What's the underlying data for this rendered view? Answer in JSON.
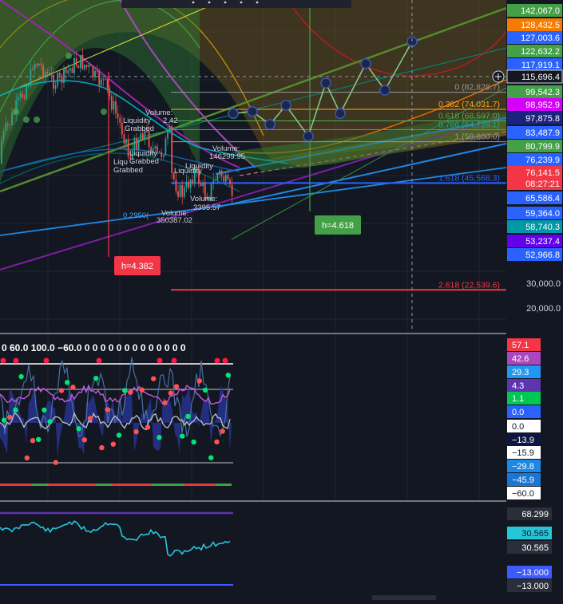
{
  "colors": {
    "background": "#131722",
    "grid": "#242a38",
    "divider": "#d1d4dc",
    "up": "#26a69a",
    "down": "#ef5350",
    "label_text": "#ffffff"
  },
  "price_axis": [
    {
      "label": "142,067.0",
      "value": 142067.0,
      "color": "#43a047"
    },
    {
      "label": "128,432.5",
      "value": 128432.5,
      "color": "#f57c00"
    },
    {
      "label": "127,003.6",
      "value": 127003.6,
      "color": "#2962ff"
    },
    {
      "label": "122,632.2",
      "value": 122632.2,
      "color": "#43a047"
    },
    {
      "label": "117,919.1",
      "value": 117919.1,
      "color": "#2962ff"
    },
    {
      "label": "115,696.4",
      "value": 115696.4,
      "color": "#131722"
    },
    {
      "label": "99,542.3",
      "value": 99542.3,
      "color": "#43a047"
    },
    {
      "label": "98,952.9",
      "value": 98952.9,
      "color": "#d500f9"
    },
    {
      "label": "97,875.8",
      "value": 97875.8,
      "color": "#1a237e"
    },
    {
      "label": "83,487.9",
      "value": 83487.9,
      "color": "#2962ff"
    },
    {
      "label": "80,799.9",
      "value": 80799.9,
      "color": "#43a047"
    },
    {
      "label": "76,239.9",
      "value": 76239.9,
      "color": "#2962ff"
    },
    {
      "label": "76,141.5",
      "value": 76141.5,
      "color": "#f23645"
    },
    {
      "label": "08:27:21",
      "value": null,
      "color": "#f23645"
    },
    {
      "label": "65,586.4",
      "value": 65586.4,
      "color": "#2962ff"
    },
    {
      "label": "59,364.0",
      "value": 59364.0,
      "color": "#2962ff"
    },
    {
      "label": "58,740.3",
      "value": 58740.3,
      "color": "#0097a7"
    },
    {
      "label": "53,237.4",
      "value": 53237.4,
      "color": "#6200ea"
    },
    {
      "label": "52,966.8",
      "value": 52966.8,
      "color": "#2962ff"
    },
    {
      "label": "30,000.0",
      "value": 30000.0,
      "color": "plain"
    },
    {
      "label": "20,000.0",
      "value": 20000.0,
      "color": "plain"
    }
  ],
  "fib_levels": [
    {
      "label": "0 (82,828.7)",
      "value": 82828.7,
      "color": "#9598a1"
    },
    {
      "label": "0.382 (74,031.7)",
      "value": 74031.7,
      "color": "#f9a825"
    },
    {
      "label": "0.618 (68,597.0)",
      "value": 68597.0,
      "color": "#4caf50"
    },
    {
      "label": "0.786 (64,728.1)",
      "value": 64728.1,
      "color": "#26a69a"
    },
    {
      "label": "1 (59,800.0)",
      "value": 59800.0,
      "color": "#9598a1"
    },
    {
      "label": "1.618 (45,568.3)",
      "value": 45568.3,
      "color": "#2962ff"
    },
    {
      "label": "2.618 (22,539.6)",
      "value": 22539.6,
      "color": "#f23645"
    }
  ],
  "measurements": [
    {
      "label": "h=4.382",
      "color": "#f23645"
    },
    {
      "label": "h=4.618",
      "color": "#43a047"
    }
  ],
  "chart_annotations": {
    "liquidity": [
      "Liquidity",
      "Grabbed"
    ],
    "liquidity_short": [
      "Liqu",
      "Grabbed"
    ],
    "liquidity_2": "Liquidity",
    "liquidity_3": "Liquidity",
    "volume_label": "Volume:",
    "volume_1_value": "2.42",
    "volume_2_value": "146299.95",
    "volume_3_value": "3395.57",
    "volume_4_value": "350387.02",
    "volume_5_label": "Volume:",
    "fib_partial": "0.2950(",
    "oscillator_header": "0  60.0  100.0  −60.0  0  0  0  0  0  0  0  0  0  0  0  0  0"
  },
  "oscillator_axis": [
    {
      "label": "57.1",
      "color": "#f23645"
    },
    {
      "label": "42.6",
      "color": "#ab47bc"
    },
    {
      "label": "29.3",
      "color": "#2196f3"
    },
    {
      "label": "4.3",
      "color": "#5e35b1"
    },
    {
      "label": "1.1",
      "color": "#00c853"
    },
    {
      "label": "0.0",
      "color": "#2962ff"
    },
    {
      "label": "0.0",
      "color": "#ffffff"
    },
    {
      "label": "−13.9",
      "color": "#0d1642"
    },
    {
      "label": "−15.9",
      "color": "#ffffff"
    },
    {
      "label": "−29.8",
      "color": "#1e88e5"
    },
    {
      "label": "−45.9",
      "color": "#1976d2"
    },
    {
      "label": "−60.0",
      "color": "#ffffff"
    }
  ],
  "lower_axis": [
    {
      "label": "68.299",
      "color": "#2a2e39"
    },
    {
      "label": "30.565",
      "color": "#26c6da"
    },
    {
      "label": "30.565",
      "color": "#2a2e39"
    },
    {
      "label": "−13.000",
      "color": "#3d5afe"
    },
    {
      "label": "−13.000",
      "color": "#2a2e39"
    }
  ],
  "chart_data": [
    {
      "type": "candlestick",
      "title": "",
      "yscale": "log",
      "ylim": [
        18000,
        150000
      ],
      "horizontal_levels": [
        82828.7,
        74031.7,
        68597.0,
        64728.1,
        59800.0,
        45568.3,
        22539.6
      ],
      "projection_path": [
        76141.5,
        72000,
        67000,
        76000,
        62000,
        88000,
        72000,
        100000,
        84000,
        105000,
        89000,
        115696.4
      ],
      "crosshair_price": 115696.4
    },
    {
      "type": "line",
      "title": "",
      "ylim": [
        -60,
        60
      ],
      "levels": [
        57.1,
        42.6,
        29.3,
        4.3,
        1.1,
        0.0,
        -13.9,
        -15.9,
        -29.8,
        -45.9,
        -60.0
      ]
    },
    {
      "type": "line",
      "title": "",
      "ylim": [
        -13,
        68.299
      ],
      "last_value": 30.565,
      "levels": [
        68.299,
        30.565,
        -13.0
      ]
    }
  ]
}
